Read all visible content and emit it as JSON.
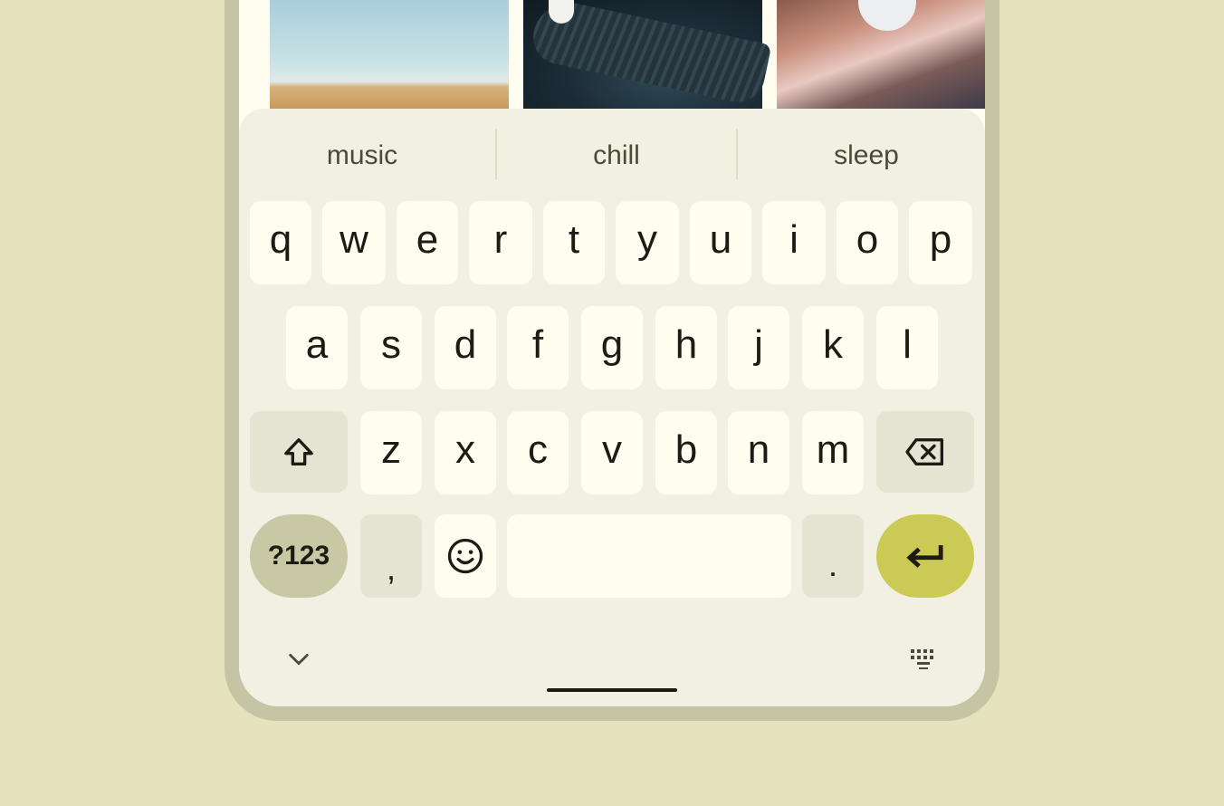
{
  "suggestions": [
    "music",
    "chill",
    "sleep"
  ],
  "keyboard": {
    "row1": [
      "q",
      "w",
      "e",
      "r",
      "t",
      "y",
      "u",
      "i",
      "o",
      "p"
    ],
    "row2": [
      "a",
      "s",
      "d",
      "f",
      "g",
      "h",
      "j",
      "k",
      "l"
    ],
    "row3": [
      "z",
      "x",
      "c",
      "v",
      "b",
      "n",
      "m"
    ],
    "symbols_label": "?123",
    "comma_label": ",",
    "period_label": ".",
    "space_label": ""
  },
  "icons": {
    "shift": "shift-icon",
    "backspace": "backspace-icon",
    "emoji": "emoji-icon",
    "enter": "enter-icon",
    "hide_keyboard": "chevron-down-icon",
    "switch_keyboard": "keyboard-icon"
  },
  "colors": {
    "background": "#e5e3be",
    "keyboard_surface": "#f1f0e2",
    "key": "#fffcf0",
    "function_key": "#e5e4d2",
    "symbols_key": "#c9c8a5",
    "enter_key": "#cbca55",
    "key_text": "#1d1c14"
  }
}
